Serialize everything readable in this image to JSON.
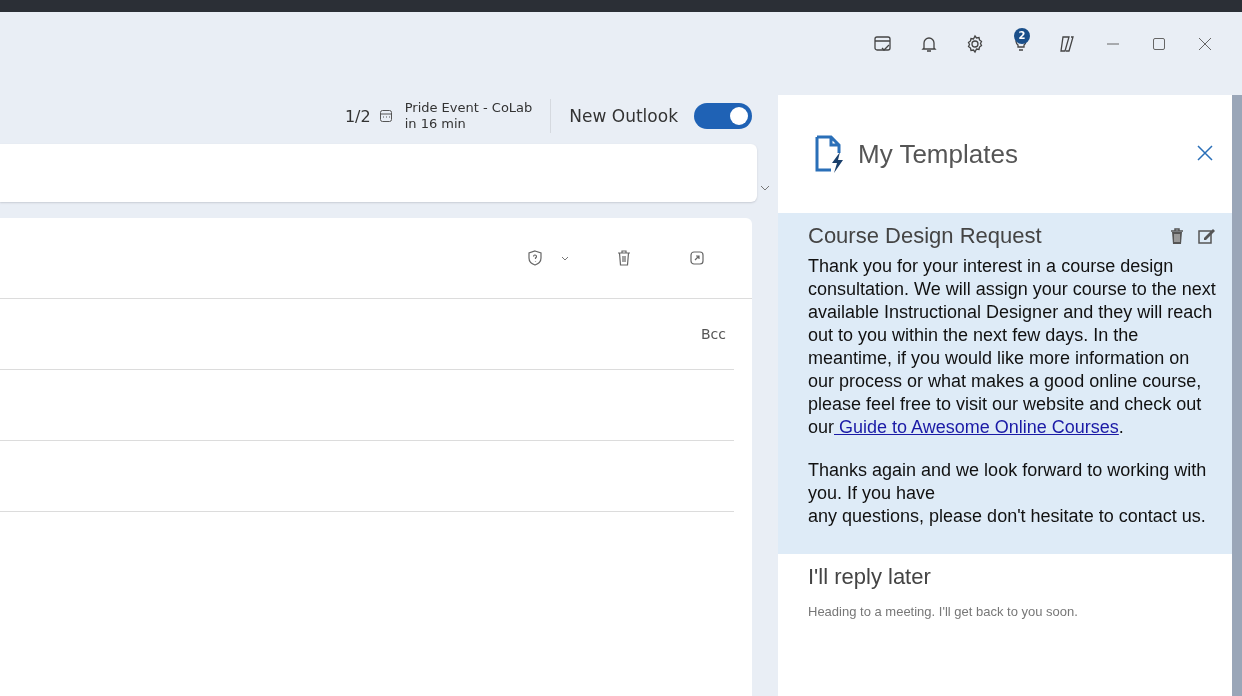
{
  "notification_badge": "2",
  "reminder": {
    "count": "1/2",
    "title": "Pride Event - CoLab",
    "time": "in 16 min"
  },
  "new_outlook": {
    "label": "New Outlook",
    "on": true
  },
  "compose": {
    "bcc": "Bcc"
  },
  "templates_pane": {
    "title": "My Templates",
    "templates": [
      {
        "title": "Course Design Request",
        "selected": true,
        "paragraphs": [
          {
            "text": "Thank you for your interest in a course design consultation. We will assign your course to the next available Instructional Designer and they will reach out to you within the next few days. In the meantime, if you would like more information on our process or what makes a good online course, please feel free to visit our website and check out our",
            "link": " Guide to Awesome Online Courses",
            "after": "."
          },
          {
            "text": "Thanks again and we look forward to working with you. If you have\nany questions, please don't hesitate to contact us."
          }
        ]
      },
      {
        "title": "I'll reply later",
        "selected": false,
        "paragraphs": [
          {
            "text": "Heading to a meeting. I'll get back to you soon."
          }
        ]
      }
    ]
  }
}
